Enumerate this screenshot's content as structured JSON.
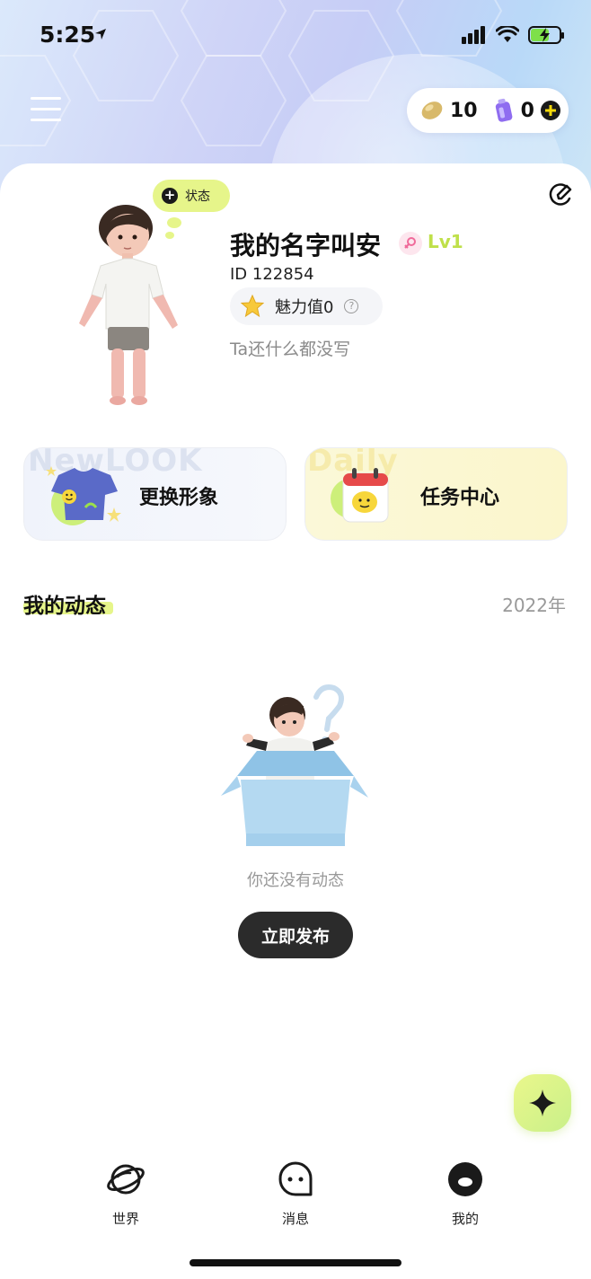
{
  "status_bar": {
    "time": "5:25"
  },
  "header": {
    "coins": "10",
    "gems": "0"
  },
  "profile": {
    "status_label": "状态",
    "username": "我的名字叫安",
    "level": "Lv1",
    "user_id": "ID 122854",
    "charm": "魅力值0",
    "bio": "Ta还什么都没写"
  },
  "features": {
    "change_look": {
      "label": "更换形象",
      "watermark": "NewLOOK"
    },
    "task_center": {
      "label": "任务中心",
      "watermark": "Daily"
    }
  },
  "feed": {
    "title": "我的动态",
    "year": "2022年",
    "empty_text": "你还没有动态",
    "publish_label": "立即发布"
  },
  "tabbar": {
    "items": [
      {
        "label": "世界",
        "icon": "planet-icon"
      },
      {
        "label": "消息",
        "icon": "message-face-icon"
      },
      {
        "label": "我的",
        "icon": "me-face-icon"
      }
    ]
  },
  "colors": {
    "accent_lime": "#e6f58a",
    "level_green": "#bfe04a",
    "button_dark": "#2b2b2b"
  }
}
